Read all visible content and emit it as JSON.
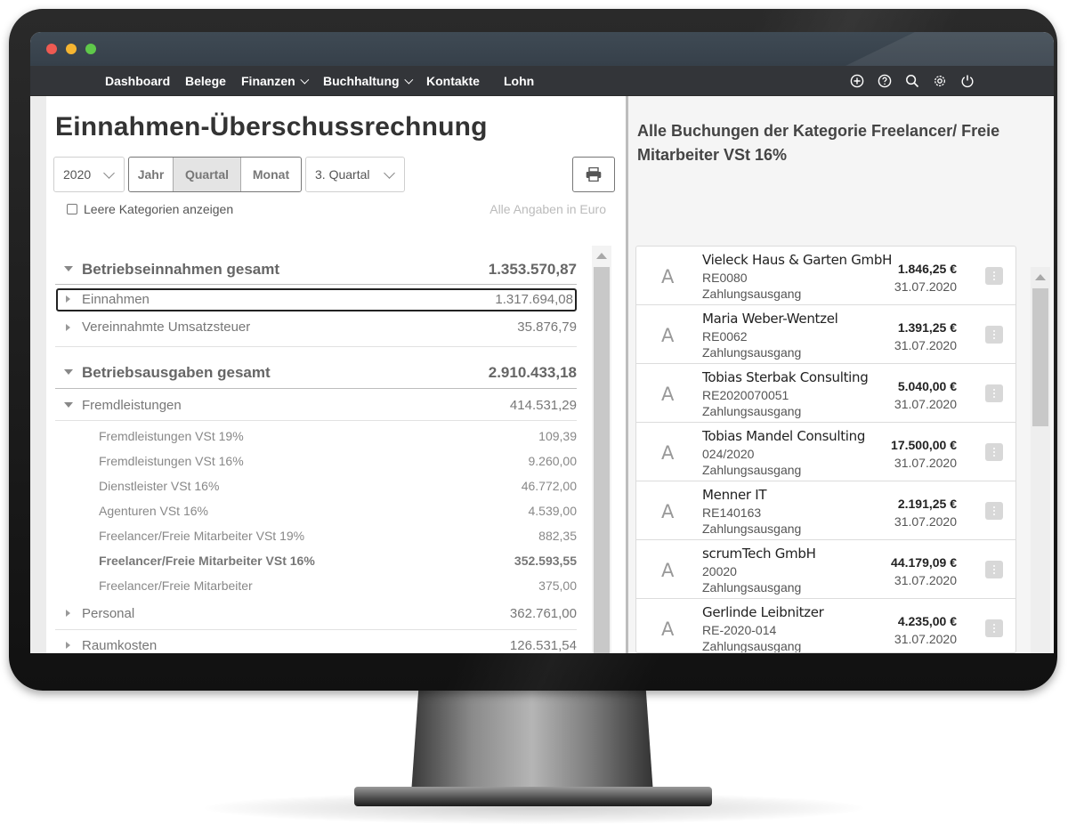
{
  "window": {
    "title": ""
  },
  "nav": {
    "items": [
      {
        "label": "Dashboard"
      },
      {
        "label": "Belege"
      },
      {
        "label": "Finanzen"
      },
      {
        "label": "Buchhaltung"
      },
      {
        "label": "Kontakte"
      },
      {
        "label": "Lohn"
      }
    ],
    "icons": [
      "add-icon",
      "help-icon",
      "search-icon",
      "settings-icon",
      "power-icon"
    ]
  },
  "report": {
    "title": "Einnahmen-Überschussrechnung",
    "year_select": "2020",
    "period_tabs": [
      "Jahr",
      "Quartal",
      "Monat"
    ],
    "active_period": "Quartal",
    "quarter_select": "3. Quartal",
    "show_empty_label": "Leere Kategorien anzeigen",
    "show_empty_checked": false,
    "currency_note": "Alle Angaben in Euro",
    "rows": [
      {
        "label": "Betriebseinnahmen gesamt",
        "value": "1.353.570,87"
      },
      {
        "label": "Einnahmen",
        "value": "1.317.694,08"
      },
      {
        "label": "Vereinnahmte Umsatzsteuer",
        "value": "35.876,79"
      },
      {
        "label": "Betriebsausgaben gesamt",
        "value": "2.910.433,18"
      },
      {
        "label": "Fremdleistungen",
        "value": "414.531,29"
      },
      {
        "label": "Fremdleistungen VSt 19%",
        "value": "109,39"
      },
      {
        "label": "Fremdleistungen VSt 16%",
        "value": "9.260,00"
      },
      {
        "label": "Dienstleister VSt 16%",
        "value": "46.772,00"
      },
      {
        "label": "Agenturen VSt 16%",
        "value": "4.539,00"
      },
      {
        "label": "Freelancer/Freie Mitarbeiter VSt 19%",
        "value": "882,35"
      },
      {
        "label": "Freelancer/Freie Mitarbeiter VSt 16%",
        "value": "352.593,55"
      },
      {
        "label": "Freelancer/Freie Mitarbeiter",
        "value": "375,00"
      },
      {
        "label": "Personal",
        "value": "362.761,00"
      },
      {
        "label": "Raumkosten",
        "value": "126.531,54"
      }
    ]
  },
  "bookings": {
    "title": "Alle Buchungen der Kategorie Freelancer/ Freie Mitarbeiter VSt 16%",
    "items": [
      {
        "avatar": "A",
        "name": "Vieleck Haus & Garten GmbH",
        "ref": "RE0080",
        "kind": "Zahlungsausgang",
        "amount": "1.846,25 €",
        "date": "31.07.2020"
      },
      {
        "avatar": "A",
        "name": "Maria Weber-Wentzel",
        "ref": "RE0062",
        "kind": "Zahlungsausgang",
        "amount": "1.391,25 €",
        "date": "31.07.2020"
      },
      {
        "avatar": "A",
        "name": "Tobias Sterbak Consulting",
        "ref": "RE2020070051",
        "kind": "Zahlungsausgang",
        "amount": "5.040,00 €",
        "date": "31.07.2020"
      },
      {
        "avatar": "A",
        "name": "Tobias Mandel Consulting",
        "ref": "024/2020",
        "kind": "Zahlungsausgang",
        "amount": "17.500,00 €",
        "date": "31.07.2020"
      },
      {
        "avatar": "A",
        "name": "Menner IT",
        "ref": "RE140163",
        "kind": "Zahlungsausgang",
        "amount": "2.191,25 €",
        "date": "31.07.2020"
      },
      {
        "avatar": "A",
        "name": "scrumTech GmbH",
        "ref": "20020",
        "kind": "Zahlungsausgang",
        "amount": "44.179,09 €",
        "date": "31.07.2020"
      },
      {
        "avatar": "A",
        "name": "Gerlinde Leibnitzer",
        "ref": "RE-2020-014",
        "kind": "Zahlungsausgang",
        "amount": "4.235,00 €",
        "date": "31.07.2020"
      }
    ]
  }
}
